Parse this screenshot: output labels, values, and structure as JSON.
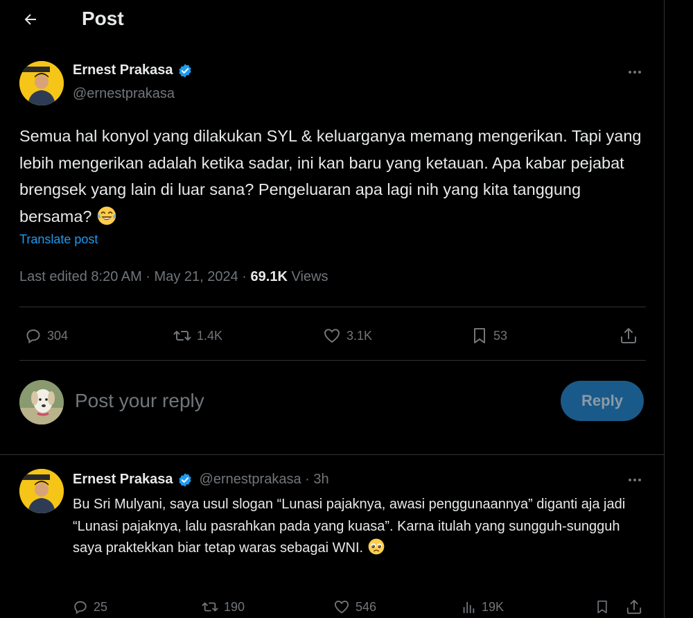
{
  "header": {
    "title": "Post"
  },
  "post": {
    "author_name": "Ernest Prakasa",
    "author_handle": "@ernestprakasa",
    "text": "Semua hal konyol yang dilakukan SYL & keluarganya memang mengerikan. Tapi yang lebih mengerikan adalah ketika sadar, ini kan baru yang ketauan. Apa kabar pejabat brengsek yang lain di luar sana? Pengeluaran apa lagi nih yang kita tanggung bersama?",
    "translate_label": "Translate post",
    "meta_prefix": "Last edited 8:20 AM · May 21, 2024 · ",
    "views_count": "69.1K",
    "views_label": " Views",
    "replies": "304",
    "reposts": "1.4K",
    "likes": "3.1K",
    "bookmarks": "53"
  },
  "composer": {
    "placeholder": "Post your reply",
    "reply_button": "Reply"
  },
  "reply": {
    "author_name": "Ernest Prakasa",
    "author_handle": "@ernestprakasa · 3h",
    "text": "Bu Sri Mulyani, saya usul slogan “Lunasi pajaknya, awasi penggunaannya” diganti aja jadi “Lunasi pajaknya, lalu pasrahkan pada yang kuasa”. Karna itulah yang sungguh-sungguh saya praktekkan biar tetap waras sebagai WNI.",
    "replies": "25",
    "reposts": "190",
    "likes": "546",
    "views": "19K"
  },
  "colors": {
    "accent": "#1d9bf0",
    "muted": "#71767b",
    "text": "#e7e9ea",
    "border": "#2f3336"
  }
}
